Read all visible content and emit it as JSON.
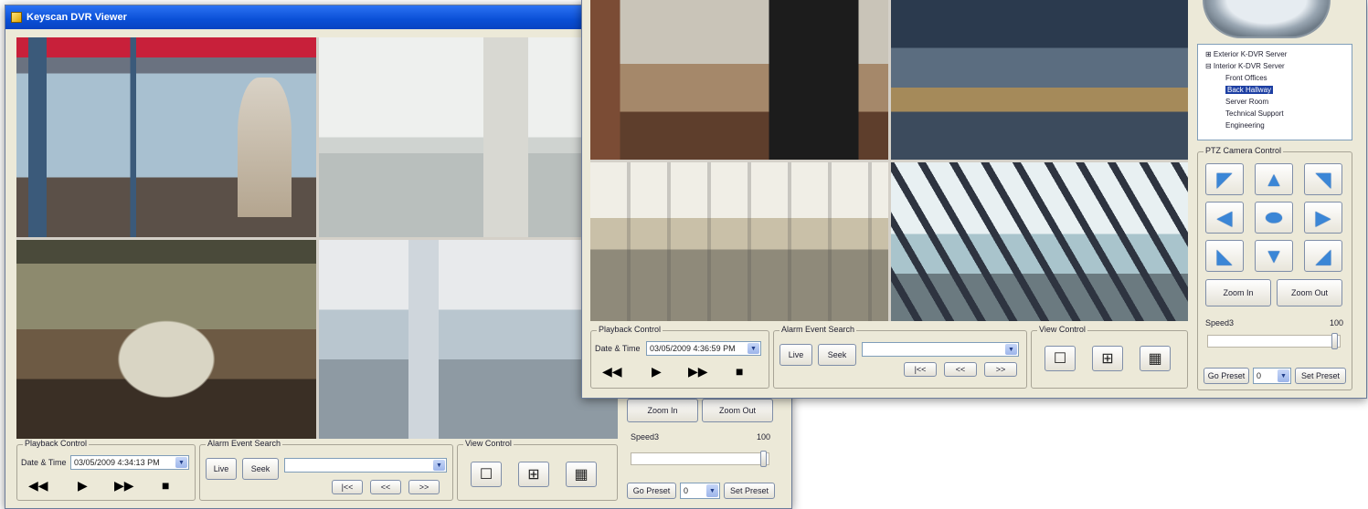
{
  "window1": {
    "title": "Keyscan DVR Viewer",
    "playback": {
      "group_title": "Playback Control",
      "date_label": "Date & Time",
      "datetime_value": "03/05/2009   4:34:13 PM",
      "controls": [
        "◀◀",
        "▶",
        "▶▶",
        "■"
      ]
    },
    "alarm": {
      "group_title": "Alarm Event Search",
      "live_label": "Live",
      "seek_label": "Seek",
      "nav": [
        "|<<",
        "<<",
        ">>"
      ]
    },
    "view": {
      "group_title": "View Control"
    },
    "ptz_partial": {
      "zoom_in": "Zoom In",
      "zoom_out": "Zoom Out",
      "speed_label": "Speed",
      "speed_value": "3",
      "speed_max": "100",
      "go_preset": "Go Preset",
      "preset_value": "0",
      "set_preset": "Set Preset"
    }
  },
  "window2": {
    "playback": {
      "group_title": "Playback Control",
      "date_label": "Date & Time",
      "datetime_value": "03/05/2009   4:36:59 PM",
      "controls": [
        "◀◀",
        "▶",
        "▶▶",
        "■"
      ]
    },
    "alarm": {
      "group_title": "Alarm Event Search",
      "live_label": "Live",
      "seek_label": "Seek",
      "nav": [
        "|<<",
        "<<",
        ">>"
      ]
    },
    "view": {
      "group_title": "View Control"
    },
    "tree": {
      "items": [
        {
          "label": "⊞  Exterior K-DVR Server",
          "level": 0
        },
        {
          "label": "⊟  Interior K-DVR Server",
          "level": 0
        },
        {
          "label": "Front Offices",
          "level": 1
        },
        {
          "label": "Back Hallway",
          "level": 1,
          "selected": true
        },
        {
          "label": "Server Room",
          "level": 1
        },
        {
          "label": "Technical Support",
          "level": 1
        },
        {
          "label": "Engineering",
          "level": 1
        }
      ]
    },
    "ptz": {
      "group_title": "PTZ Camera Control",
      "zoom_in": "Zoom In",
      "zoom_out": "Zoom Out",
      "speed_label": "Speed",
      "speed_value": "3",
      "speed_max": "100",
      "go_preset": "Go Preset",
      "preset_value": "0",
      "set_preset": "Set Preset"
    }
  },
  "colors": {
    "title_bar": "#0a4fd6",
    "window_bg": "#ece9d8",
    "selection": "#1d3fa3",
    "ptz_arrow": "#3b86d6"
  },
  "icons": [
    "app-icon",
    "single-view-icon",
    "quad-view-icon",
    "nine-view-icon",
    "ptz-arrow-icons"
  ]
}
